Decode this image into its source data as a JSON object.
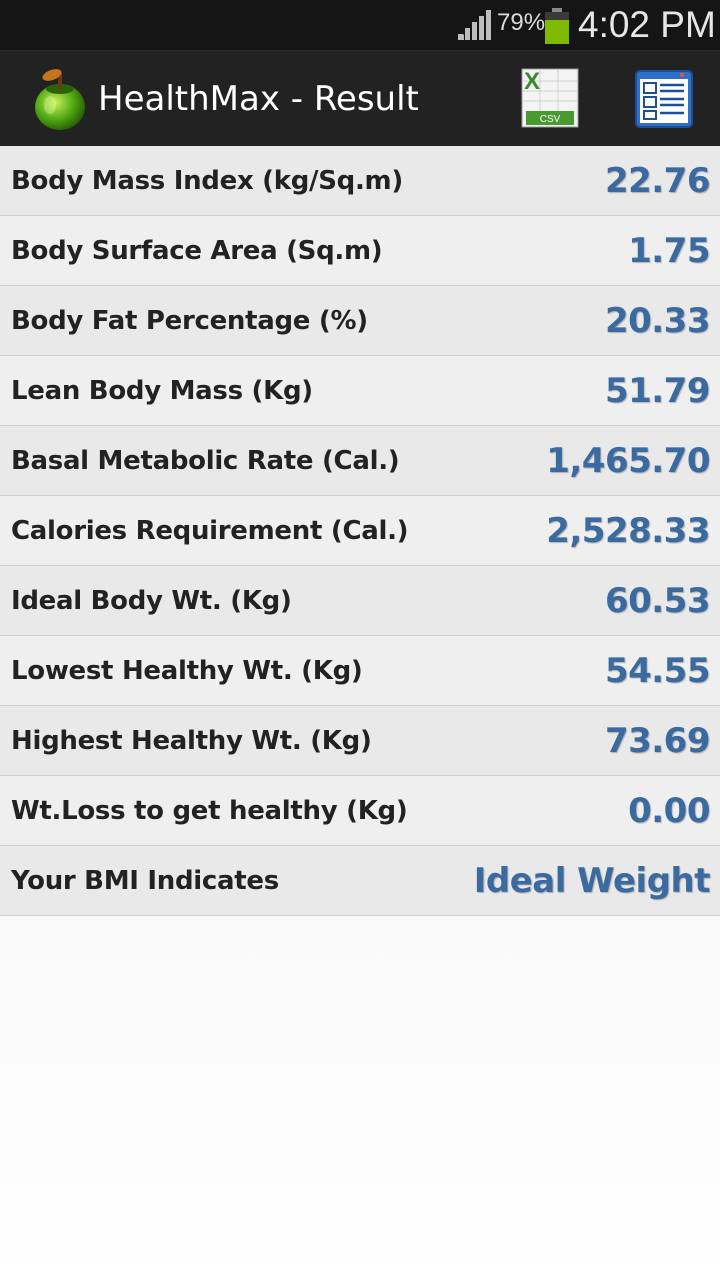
{
  "status_bar": {
    "battery_percent": "79%",
    "time": "4:02 PM"
  },
  "action_bar": {
    "title": "HealthMax - Result",
    "csv_label": "CSV"
  },
  "results": [
    {
      "label": "Body Mass Index (kg/Sq.m)",
      "value": "22.76"
    },
    {
      "label": "Body Surface Area (Sq.m)",
      "value": "1.75"
    },
    {
      "label": "Body Fat Percentage (%)",
      "value": "20.33"
    },
    {
      "label": "Lean Body Mass (Kg)",
      "value": "51.79"
    },
    {
      "label": "Basal Metabolic Rate (Cal.)",
      "value": "1,465.70"
    },
    {
      "label": "Calories Requirement (Cal.)",
      "value": "2,528.33"
    },
    {
      "label": "Ideal Body Wt. (Kg)",
      "value": "60.53"
    },
    {
      "label": "Lowest Healthy Wt. (Kg)",
      "value": "54.55"
    },
    {
      "label": "Highest Healthy Wt. (Kg)",
      "value": "73.69"
    },
    {
      "label": "Wt.Loss to get healthy (Kg)",
      "value": "0.00"
    },
    {
      "label": "Your BMI Indicates",
      "value": "Ideal Weight"
    }
  ],
  "colors": {
    "value_text": "#3a6aa0",
    "action_bar": "#222222",
    "status_bar": "#151515"
  }
}
